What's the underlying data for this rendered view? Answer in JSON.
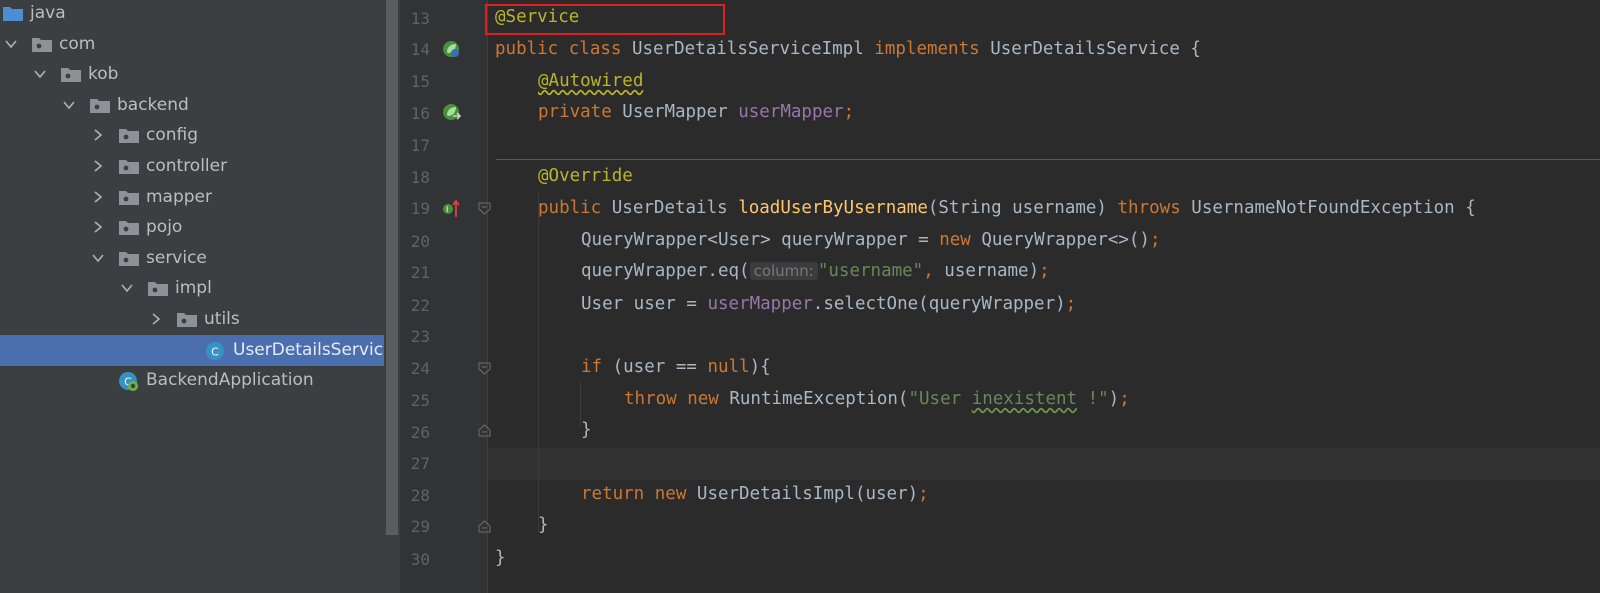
{
  "project_tree": {
    "items": [
      {
        "label": "java",
        "type": "folder-blue",
        "depth": 0,
        "chevron": "none"
      },
      {
        "label": "com",
        "type": "package",
        "depth": 1,
        "chevron": "down"
      },
      {
        "label": "kob",
        "type": "package",
        "depth": 2,
        "chevron": "down"
      },
      {
        "label": "backend",
        "type": "package",
        "depth": 3,
        "chevron": "down"
      },
      {
        "label": "config",
        "type": "package",
        "depth": 4,
        "chevron": "right"
      },
      {
        "label": "controller",
        "type": "package",
        "depth": 4,
        "chevron": "right"
      },
      {
        "label": "mapper",
        "type": "package",
        "depth": 4,
        "chevron": "right"
      },
      {
        "label": "pojo",
        "type": "package",
        "depth": 4,
        "chevron": "right"
      },
      {
        "label": "service",
        "type": "package",
        "depth": 4,
        "chevron": "down"
      },
      {
        "label": "impl",
        "type": "package",
        "depth": 5,
        "chevron": "down"
      },
      {
        "label": "utils",
        "type": "package",
        "depth": 6,
        "chevron": "right"
      },
      {
        "label": "UserDetailsServiceImpl",
        "type": "class",
        "depth": 7,
        "chevron": "none",
        "selected": true
      },
      {
        "label": "BackendApplication",
        "type": "spring-app",
        "depth": 4,
        "chevron": "none"
      }
    ]
  },
  "editor": {
    "line_numbers": [
      "13",
      "14",
      "15",
      "16",
      "17",
      "18",
      "19",
      "20",
      "21",
      "22",
      "23",
      "24",
      "25",
      "26",
      "27",
      "28",
      "29",
      "30"
    ],
    "code": {
      "l13": "@Service",
      "l14_kw1": "public class ",
      "l14_name": "UserDetailsServiceImpl ",
      "l14_kw2": "implements ",
      "l14_rest": "UserDetailsService {",
      "l15": "@Autowired",
      "l16_kw": "private ",
      "l16_type": "UserMapper ",
      "l16_field": "userMapper",
      "l16_semi": ";",
      "l18": "@Override",
      "l19_kw": "public ",
      "l19_type": "UserDetails ",
      "l19_method": "loadUserByUsername",
      "l19_params": "(String username) ",
      "l19_throws": "throws ",
      "l19_rest": "UsernameNotFoundException {",
      "l20_a": "QueryWrapper<User> queryWrapper = ",
      "l20_new": "new ",
      "l20_b": "QueryWrapper<>()",
      "l20_semi": ";",
      "l21_a": "queryWrapper.eq(",
      "l21_hint": "column:",
      "l21_str": "\"username\"",
      "l21_comma": ", ",
      "l21_b": "username)",
      "l21_semi": ";",
      "l22_a": "User user = ",
      "l22_field": "userMapper",
      "l22_b": ".selectOne(queryWrapper)",
      "l22_semi": ";",
      "l24_kw": "if ",
      "l24_a": "(user == ",
      "l24_null": "null",
      "l24_b": "){",
      "l25_kw": "throw new ",
      "l25_a": "RuntimeException(",
      "l25_str1": "\"User ",
      "l25_str2": "inexistent",
      "l25_str3": " !\"",
      "l25_b": ")",
      "l25_semi": ";",
      "l26": "}",
      "l28_kw": "return new ",
      "l28_a": "UserDetailsImpl(user)",
      "l28_semi": ";",
      "l29": "}",
      "l30": "}"
    }
  },
  "colors": {
    "keyword": "#cc7832",
    "annotation": "#bbb529",
    "field": "#9876aa",
    "method": "#ffc66d",
    "string": "#6a8759",
    "highlight_box": "#e02020",
    "selection": "#4b6eaf"
  },
  "icons": {
    "gutter_line14": "spring-bean-icon",
    "gutter_line16": "autowired-navigate-icon",
    "gutter_line19": "implements-method-icon"
  }
}
